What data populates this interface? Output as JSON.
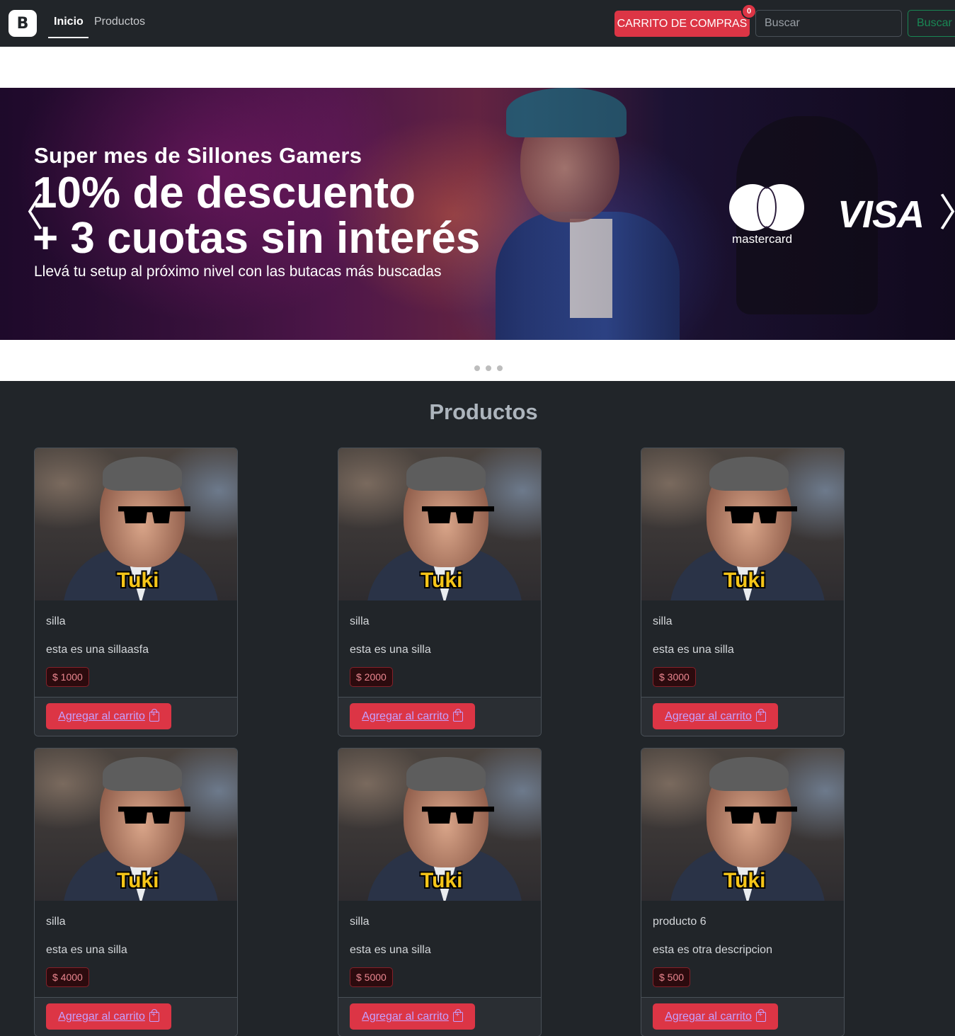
{
  "navbar": {
    "brand_letter": "B",
    "links": [
      {
        "label": "Inicio",
        "active": true
      },
      {
        "label": "Productos",
        "active": false
      }
    ],
    "cart_label": "CARRITO DE COMPRAS",
    "cart_count": "0",
    "search_placeholder": "Buscar",
    "search_button": "Buscar"
  },
  "carousel": {
    "line1": "Super mes de Sillones Gamers",
    "line2": "10% de descuento",
    "line3": "+ 3 cuotas sin interés",
    "line4": "Llevá tu setup al próximo nivel con las butacas más buscadas",
    "mastercard_label": "mastercard",
    "visa_label": "VISA",
    "prev_glyph": "〈",
    "next_glyph": "〈",
    "indicator_count": 3
  },
  "products": {
    "title": "Productos",
    "image_caption": "Tuki",
    "add_label": "Agregar al carrito",
    "items": [
      {
        "name": "silla",
        "description": "esta es una sillaasfa",
        "price": "$ 1000"
      },
      {
        "name": "silla",
        "description": "esta es una silla",
        "price": "$ 2000"
      },
      {
        "name": "silla",
        "description": "esta es una silla",
        "price": "$ 3000"
      },
      {
        "name": "silla",
        "description": "esta es una silla",
        "price": "$ 4000"
      },
      {
        "name": "silla",
        "description": "esta es una silla",
        "price": "$ 5000"
      },
      {
        "name": "producto 6",
        "description": "esta es otra descripcion",
        "price": "$ 500"
      }
    ]
  },
  "colors": {
    "navbar_bg": "#212529",
    "danger": "#dc3545",
    "success": "#198754"
  }
}
